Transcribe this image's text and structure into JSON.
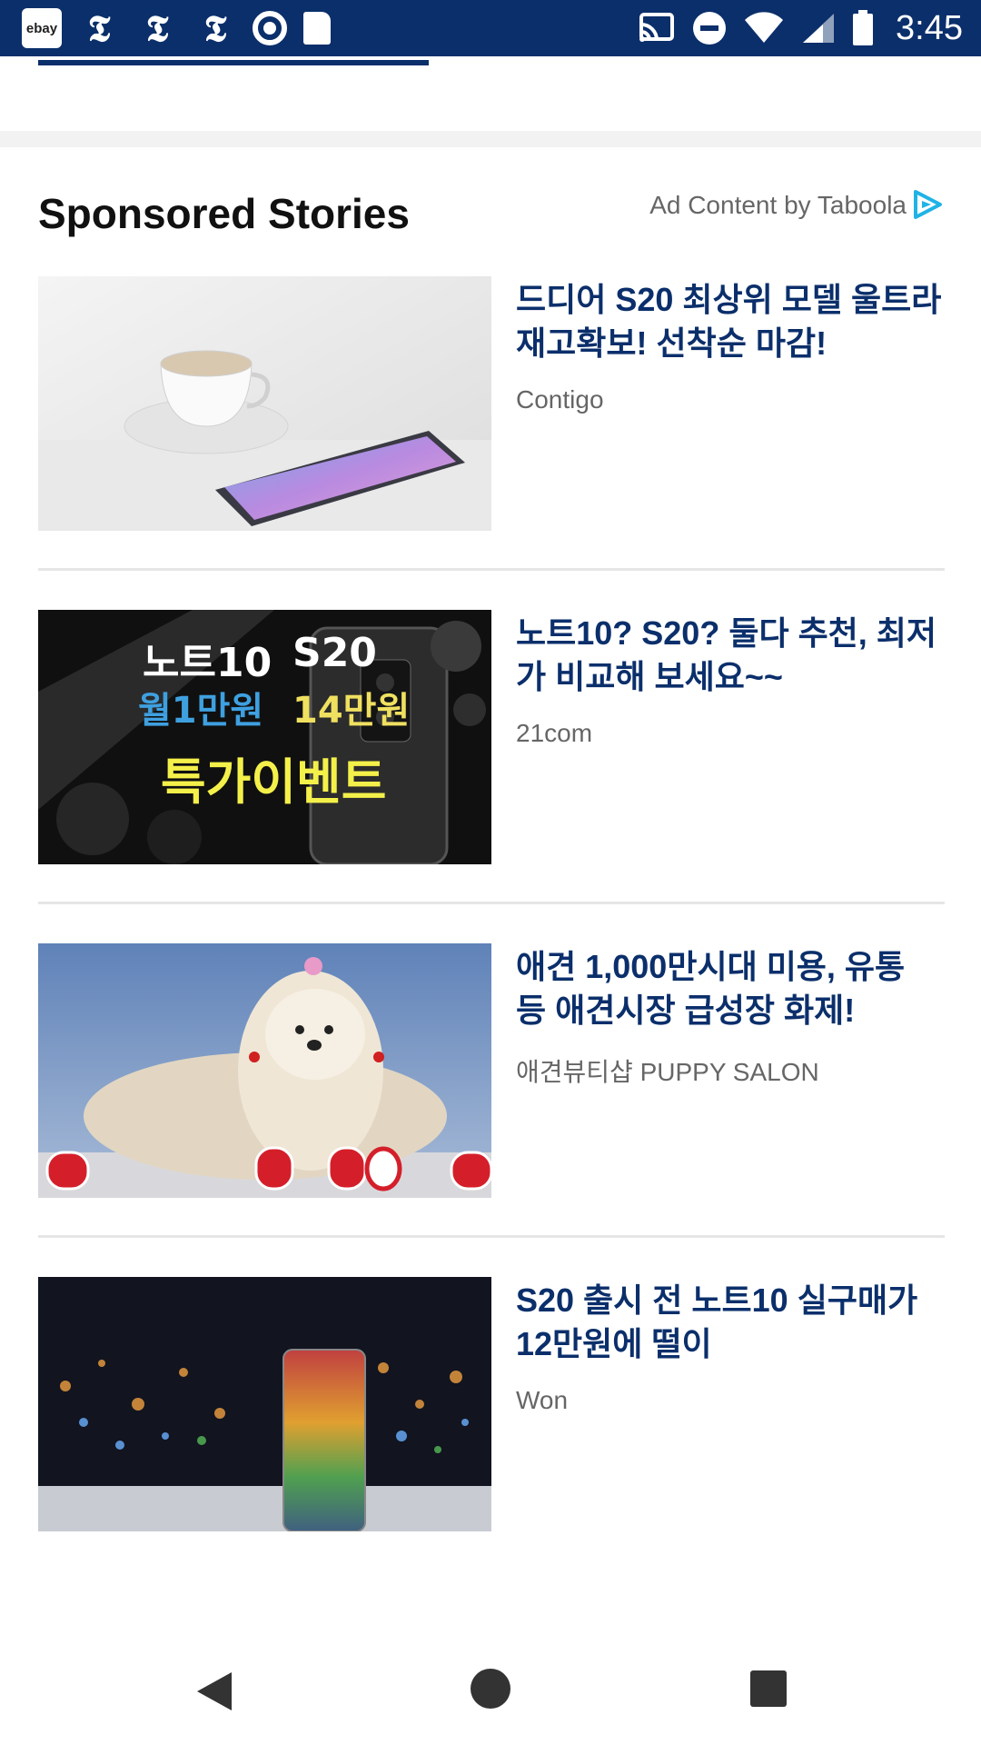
{
  "status_bar": {
    "left_icons": [
      "ebay-app-icon",
      "nytimes-icon",
      "nytimes-icon",
      "nytimes-icon",
      "circle-app-icon",
      "sd-card-icon"
    ],
    "ebay_label": "ebay",
    "nyt_glyph": "𝕿",
    "right_icons": [
      "cast-icon",
      "do-not-disturb-icon",
      "wifi-icon",
      "cell-signal-icon",
      "battery-icon"
    ],
    "time": "3:45"
  },
  "sponsored": {
    "title": "Sponsored Stories",
    "ad_label": "Ad Content by Taboola",
    "stories": [
      {
        "headline": "드디어 S20 최상위 모델 울트라 재고확보! 선착순 마감!",
        "source": "Contigo",
        "image": "phone-and-coffee-cup-photo"
      },
      {
        "headline": "노트10? S20? 둘다 추천, 최저가 비교해 보세요~~",
        "source": "21com",
        "image": "phone-promo-banner",
        "banner_text": {
          "line1_left": "노트10",
          "line1_right": "S20",
          "line2_left": "월1만원",
          "line2_right": "14만원",
          "line3": "특가이벤트"
        }
      },
      {
        "headline": "애견 1,000만시대 미용, 유통 등 애견시장 급성장 화제!",
        "source": "애견뷰티샵 PUPPY SALON",
        "image": "shih-tzu-dog-photo"
      },
      {
        "headline": "S20 출시 전 노트10 실구매가 12만원에 떨이",
        "source": "Won",
        "image": "phone-city-night-photo"
      }
    ]
  },
  "colors": {
    "status_bar": "#0b2f6b",
    "headline": "#0b2f6b",
    "taboola_accent": "#1fb3e6"
  },
  "nav_bar": {
    "buttons": [
      "back-icon",
      "home-icon",
      "recents-icon"
    ]
  }
}
